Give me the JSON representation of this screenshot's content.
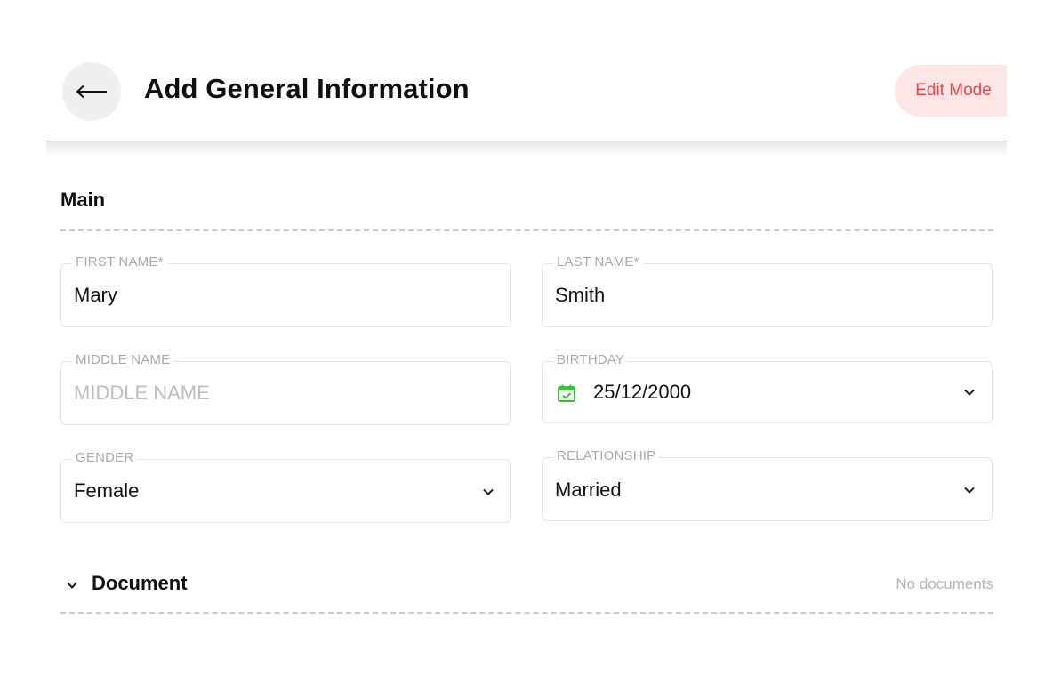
{
  "header": {
    "back_icon": "arrow-left-icon",
    "title": "Add General Information",
    "edit_mode_label": "Edit Mode"
  },
  "colors": {
    "accent_text": "#e8484a",
    "accent_bg": "#fde6e6",
    "calendar_icon": "#3dbf3d"
  },
  "main": {
    "section_title": "Main",
    "fields": {
      "first_name": {
        "label": "FIRST NAME*",
        "value": "Mary"
      },
      "last_name": {
        "label": "LAST NAME*",
        "value": "Smith"
      },
      "middle_name": {
        "label": "MIDDLE NAME",
        "value": "",
        "placeholder": "MIDDLE NAME"
      },
      "birthday": {
        "label": "BIRTHDAY",
        "value": "25/12/2000",
        "icon": "calendar-check-icon"
      },
      "gender": {
        "label": "GENDER",
        "value": "Female"
      },
      "relationship": {
        "label": "RELATIONSHIP",
        "value": "Married"
      }
    }
  },
  "document": {
    "section_title": "Document",
    "empty_text": "No documents"
  }
}
